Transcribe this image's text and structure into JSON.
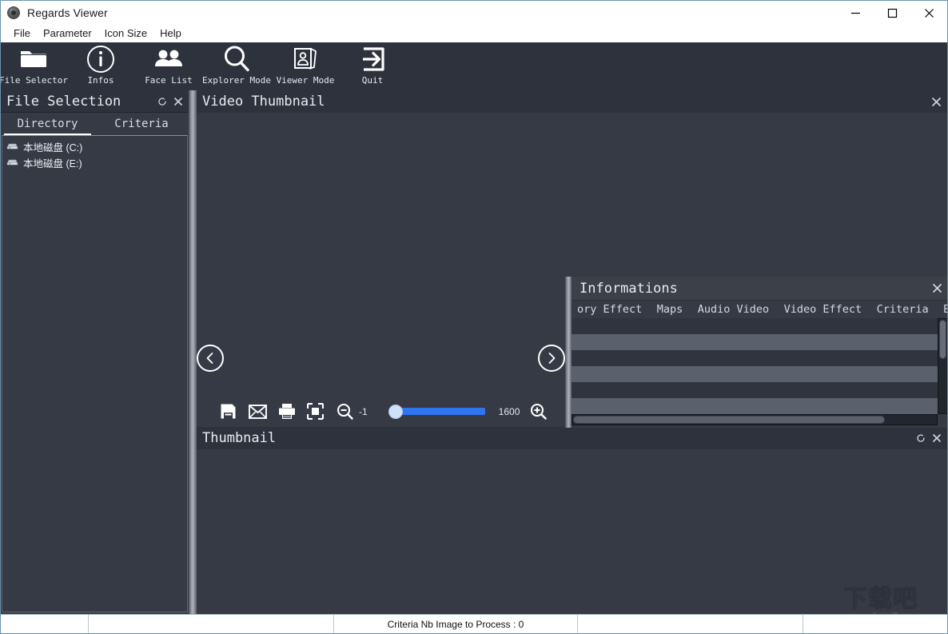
{
  "window": {
    "title": "Regards Viewer",
    "icon": "camera-icon",
    "controls": {
      "minimize": "minimize-icon",
      "maximize": "maximize-icon",
      "close": "close-icon"
    }
  },
  "menubar": {
    "items": [
      {
        "label": "File"
      },
      {
        "label": "Parameter"
      },
      {
        "label": "Icon Size"
      },
      {
        "label": "Help"
      }
    ]
  },
  "toolbar": {
    "buttons": [
      {
        "label": "File Selector",
        "icon": "folder-icon"
      },
      {
        "label": "Infos",
        "icon": "info-circle-icon"
      },
      {
        "label": "Face List",
        "icon": "people-icon"
      },
      {
        "label": "Explorer Mode",
        "icon": "magnifier-icon"
      },
      {
        "label": "Viewer Mode",
        "icon": "portrait-pages-icon"
      },
      {
        "label": "Quit",
        "icon": "exit-arrow-icon"
      }
    ]
  },
  "file_selection": {
    "title": "File Selection",
    "refresh_icon": "refresh-icon",
    "close_icon": "close-icon",
    "tabs": [
      {
        "label": "Directory",
        "active": true
      },
      {
        "label": "Criteria",
        "active": false
      }
    ],
    "tree": [
      {
        "label": "本地磁盘 (C:)",
        "icon": "drive-icon"
      },
      {
        "label": "本地磁盘 (E:)",
        "icon": "drive-icon"
      }
    ]
  },
  "video_thumbnail": {
    "title": "Video Thumbnail",
    "close_icon": "close-icon",
    "prev_icon": "chevron-left-circle-icon",
    "next_icon": "chevron-right-circle-icon",
    "tools": {
      "save_icon": "save-floppy-icon",
      "mail_icon": "envelope-icon",
      "print_icon": "printer-icon",
      "fit_icon": "fit-to-frame-icon",
      "zoom_out_icon": "zoom-out-icon",
      "zoom_out_value": "-1",
      "zoom_in_icon": "zoom-in-icon",
      "zoom_in_value": "1600",
      "slider_position_percent": 0
    }
  },
  "thumbnail": {
    "title": "Thumbnail",
    "refresh_icon": "refresh-icon",
    "close_icon": "close-icon"
  },
  "informations": {
    "title": "Informations",
    "close_icon": "close-icon",
    "tabs": [
      {
        "label": "ory Effect",
        "clipped": true
      },
      {
        "label": "Maps"
      },
      {
        "label": "Audio Video"
      },
      {
        "label": "Video Effect"
      },
      {
        "label": "Criteria"
      },
      {
        "label": "Effect",
        "clipped": true
      }
    ],
    "rows": [
      {
        "style": "norm"
      },
      {
        "style": "alt"
      },
      {
        "style": "norm"
      },
      {
        "style": "alt"
      },
      {
        "style": "norm"
      },
      {
        "style": "alt"
      }
    ]
  },
  "statusbar": {
    "cells": [
      {
        "text": ""
      },
      {
        "text": ""
      },
      {
        "text": "Criteria Nb Image to Process :  0"
      },
      {
        "text": ""
      },
      {
        "text": ""
      }
    ]
  },
  "watermark": {
    "top": "下载吧",
    "bottom": "www.xiazaiba.com"
  },
  "colors": {
    "panel_bg": "#353a45",
    "panel_header_bg": "#2e323c",
    "accent_blue": "#2f74f0",
    "titlebar_bg": "#ffffff",
    "row_alt": "#5b616c"
  }
}
